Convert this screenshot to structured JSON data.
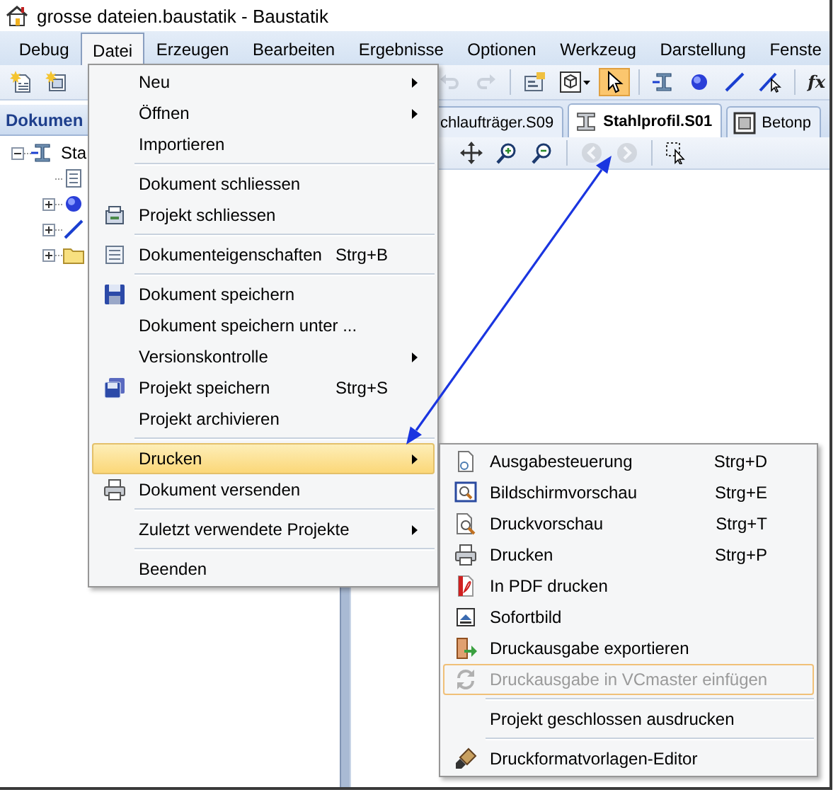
{
  "window": {
    "title": "grosse dateien.baustatik - Baustatik"
  },
  "menu_bar": [
    {
      "label": "Debug",
      "selected": false
    },
    {
      "label": "Datei",
      "selected": true
    },
    {
      "label": "Erzeugen",
      "selected": false
    },
    {
      "label": "Bearbeiten",
      "selected": false
    },
    {
      "label": "Ergebnisse",
      "selected": false
    },
    {
      "label": "Optionen",
      "selected": false
    },
    {
      "label": "Werkzeug",
      "selected": false
    },
    {
      "label": "Darstellung",
      "selected": false
    },
    {
      "label": "Fenste",
      "selected": false
    }
  ],
  "toolbar": [
    {
      "kind": "new-document",
      "selected": false,
      "disabled": false
    },
    {
      "kind": "new-project",
      "selected": false,
      "disabled": false
    },
    {
      "kind": "gap"
    },
    {
      "kind": "separator"
    },
    {
      "kind": "undo",
      "selected": false,
      "disabled": true
    },
    {
      "kind": "redo",
      "selected": false,
      "disabled": true
    },
    {
      "kind": "separator"
    },
    {
      "kind": "properties",
      "selected": false,
      "disabled": false
    },
    {
      "kind": "view",
      "selected": false,
      "disabled": false
    },
    {
      "kind": "pointer",
      "selected": true,
      "disabled": false
    },
    {
      "kind": "separator"
    },
    {
      "kind": "beam",
      "selected": false,
      "disabled": false
    },
    {
      "kind": "sphere",
      "selected": false,
      "disabled": false
    },
    {
      "kind": "line",
      "selected": false,
      "disabled": false
    },
    {
      "kind": "line-pointer",
      "selected": false,
      "disabled": false
    },
    {
      "kind": "separator"
    },
    {
      "kind": "formula",
      "label": "fx",
      "selected": false,
      "disabled": false
    }
  ],
  "document_panel": {
    "title": "Dokumen",
    "tree": [
      {
        "kind": "beam",
        "label": "Sta",
        "expanded": true,
        "children": [
          {
            "kind": "document"
          },
          {
            "kind": "sphere",
            "expanded": false
          },
          {
            "kind": "line",
            "expanded": false
          },
          {
            "kind": "folder",
            "expanded": false
          }
        ]
      }
    ]
  },
  "tabs": [
    {
      "label": "chlaufträger.S09",
      "selected": false
    },
    {
      "label": "Stahlprofil.S01",
      "selected": true
    },
    {
      "label": "Betonp",
      "selected": false
    }
  ],
  "view_toolbar": [
    {
      "kind": "move",
      "disabled": false
    },
    {
      "kind": "zoom-in",
      "disabled": false
    },
    {
      "kind": "zoom-out",
      "disabled": false
    },
    {
      "kind": "separator"
    },
    {
      "kind": "back",
      "disabled": true
    },
    {
      "kind": "forward",
      "disabled": true
    },
    {
      "kind": "separator"
    },
    {
      "kind": "select",
      "disabled": false
    }
  ],
  "file_menu": {
    "items": [
      {
        "kind": "item",
        "label": "Neu",
        "submenu": true,
        "selected": false
      },
      {
        "kind": "item",
        "label": "Öffnen",
        "submenu": true,
        "selected": false
      },
      {
        "kind": "item",
        "label": "Importieren",
        "submenu": false,
        "selected": false
      },
      {
        "kind": "separator"
      },
      {
        "kind": "item",
        "label": "Dokument schliessen",
        "submenu": false,
        "selected": false
      },
      {
        "kind": "item",
        "label": "Projekt schliessen",
        "submenu": false,
        "selected": false
      },
      {
        "kind": "separator"
      },
      {
        "kind": "item",
        "label": "Dokumenteigenschaften",
        "shortcut": "Strg+B",
        "submenu": false,
        "selected": false
      },
      {
        "kind": "separator"
      },
      {
        "kind": "item",
        "label": "Dokument speichern",
        "submenu": false,
        "selected": false
      },
      {
        "kind": "item",
        "label": "Dokument speichern unter ...",
        "submenu": false,
        "selected": false
      },
      {
        "kind": "item",
        "label": "Versionskontrolle",
        "submenu": true,
        "selected": false
      },
      {
        "kind": "item",
        "label": "Projekt speichern",
        "shortcut": "Strg+S",
        "submenu": false,
        "selected": false
      },
      {
        "kind": "item",
        "label": "Projekt archivieren",
        "submenu": false,
        "selected": false
      },
      {
        "kind": "separator"
      },
      {
        "kind": "item",
        "label": "Drucken",
        "submenu": true,
        "selected": true
      },
      {
        "kind": "item",
        "label": "Dokument versenden",
        "submenu": false,
        "selected": false
      },
      {
        "kind": "separator"
      },
      {
        "kind": "item",
        "label": "Zuletzt verwendete Projekte",
        "submenu": true,
        "selected": false
      },
      {
        "kind": "separator"
      },
      {
        "kind": "item",
        "label": "Beenden",
        "submenu": false,
        "selected": false
      }
    ]
  },
  "print_submenu": {
    "items": [
      {
        "kind": "item",
        "label": "Ausgabesteuerung",
        "shortcut": "Strg+D",
        "disabled": false,
        "selected": false
      },
      {
        "kind": "item",
        "label": "Bildschirmvorschau",
        "shortcut": "Strg+E",
        "disabled": false,
        "selected": false
      },
      {
        "kind": "item",
        "label": "Druckvorschau",
        "shortcut": "Strg+T",
        "disabled": false,
        "selected": false
      },
      {
        "kind": "item",
        "label": "Drucken",
        "shortcut": "Strg+P",
        "disabled": false,
        "selected": false
      },
      {
        "kind": "item",
        "label": "In PDF drucken",
        "disabled": false,
        "selected": false
      },
      {
        "kind": "item",
        "label": "Sofortbild",
        "disabled": false,
        "selected": false
      },
      {
        "kind": "item",
        "label": "Druckausgabe exportieren",
        "disabled": false,
        "selected": false
      },
      {
        "kind": "item",
        "label": "Druckausgabe in VCmaster einfügen",
        "disabled": true,
        "selected": true
      },
      {
        "kind": "separator"
      },
      {
        "kind": "item",
        "label": "Projekt geschlossen ausdrucken",
        "disabled": false,
        "selected": false
      },
      {
        "kind": "separator"
      },
      {
        "kind": "item",
        "label": "Druckformatvorlagen-Editor",
        "disabled": false,
        "selected": false
      }
    ]
  }
}
